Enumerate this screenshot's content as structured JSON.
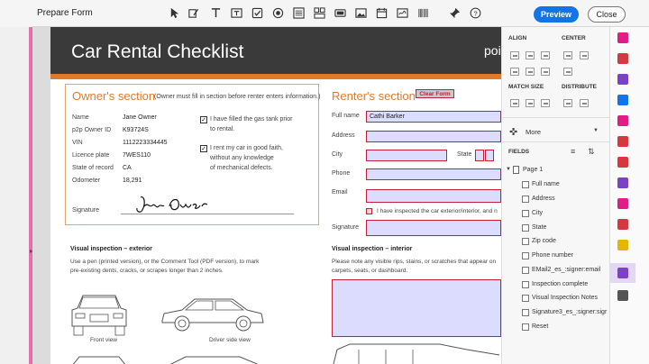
{
  "toolbar": {
    "title": "Prepare Form",
    "icons": [
      "select-cursor-icon",
      "edit-tool-icon",
      "text-field-icon",
      "text-box-icon",
      "checkbox-icon",
      "radio-button-icon",
      "list-box-icon",
      "dropdown-icon",
      "image-field-icon",
      "date-field-icon",
      "signature-field-icon",
      "barcode-icon",
      "pin-icon",
      "help-icon"
    ],
    "preview_label": "Preview",
    "close_label": "Close"
  },
  "document": {
    "banner_title": "Car Rental Checklist",
    "banner_right": "poi",
    "owner": {
      "section_title": "Owner's section",
      "section_note": "(Owner must fill in section before renter enters information.)",
      "rows": [
        {
          "label": "Name",
          "value": "Jane Owner"
        },
        {
          "label": "p2p Owner ID",
          "value": "K93724S"
        },
        {
          "label": "VIN",
          "value": "1112223334445"
        },
        {
          "label": "Licence plate",
          "value": "7WES110"
        },
        {
          "label": "State of record",
          "value": "CA"
        },
        {
          "label": "Odometer",
          "value": "18,291"
        }
      ],
      "checks": [
        {
          "line1": "I have filled the gas tank prior",
          "line2": "to rental.",
          "line3": ""
        },
        {
          "line1": "I rent my car in good faith,",
          "line2": "without any knowledge",
          "line3": "of mechanical defects."
        }
      ],
      "signature_label": "Signature",
      "signature_value": "Jane Owner"
    },
    "renter": {
      "section_title": "Renter's section",
      "clear_label": "Clear Form",
      "full_name_label": "Full name",
      "full_name_value": "Cathi Barker",
      "address_label": "Address",
      "city_label": "City",
      "state_label": "State",
      "phone_label": "Phone",
      "email_label": "Email",
      "inspected_text": "I have inspected the car exterior/interior, and n",
      "signature_label": "Signature"
    },
    "exterior": {
      "title": "Visual inspection – exterior",
      "line1": "Use a pen (printed version), or the Comment Tool (PDF version), to mark",
      "line2": "pre-existing dents, cracks, or scrapes longer than 2 inches.",
      "front_label": "Front view",
      "side_label": "Driver side view"
    },
    "interior": {
      "title": "Visual inspection – interior",
      "line1": "Please note any visible rips, stains, or scratches that appear on",
      "line2": "carpets, seats, or dashboard."
    }
  },
  "panel": {
    "align_label": "ALIGN",
    "center_label": "CENTER",
    "match_size_label": "MATCH SIZE",
    "distribute_label": "DISTRIBUTE",
    "more_label": "More",
    "fields_label": "FIELDS",
    "page_label": "Page 1",
    "fields": [
      "Full name",
      "Address",
      "City",
      "State",
      "Zip code",
      "Phone number",
      "EMail2_es_:signer:email",
      "Inspection complete",
      "Visual Inspection Notes",
      "Signature3_es_:signer:sigr",
      "Reset"
    ]
  },
  "colors": {
    "accent": "#1473e6",
    "banner": "#3a3a3a",
    "orange": "#e07a2b",
    "field_border": "#c0203a",
    "field_fill": "#dcdcff"
  }
}
